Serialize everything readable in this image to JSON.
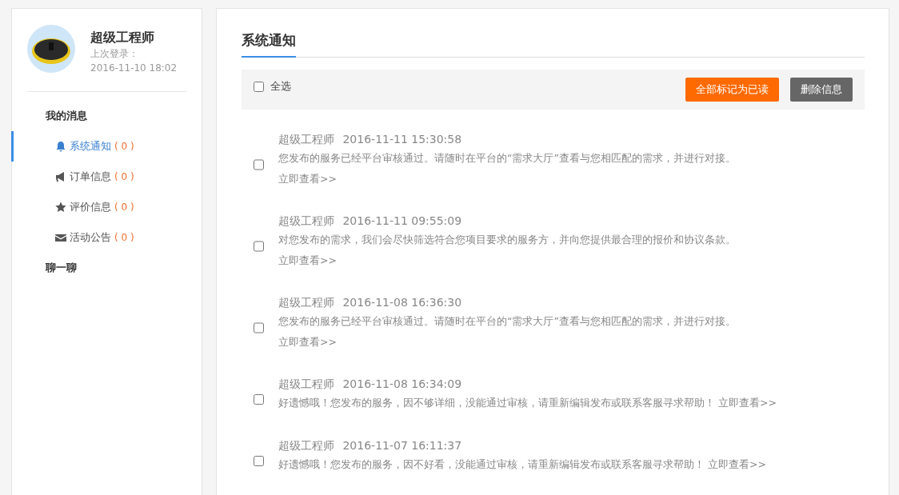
{
  "user": {
    "name": "超级工程师",
    "last_login_label": "上次登录：",
    "last_login_time": "2016-11-10 18:02"
  },
  "sidebar": {
    "sections": [
      {
        "title": "我的消息",
        "items": [
          {
            "label": "系统通知",
            "count": "( 0 )",
            "selected": true
          },
          {
            "label": "订单信息",
            "count": "( 0 )",
            "selected": false
          },
          {
            "label": "评价信息",
            "count": "( 0 )",
            "selected": false
          },
          {
            "label": "活动公告",
            "count": "( 0 )",
            "selected": false
          }
        ]
      },
      {
        "title": "聊一聊"
      }
    ]
  },
  "main": {
    "title": "系统通知",
    "select_all": {
      "label": "全选",
      "checked": false
    },
    "buttons": [
      {
        "label": "全部标记为已读",
        "kind": "primary"
      },
      {
        "label": "删除信息",
        "kind": "secondary"
      }
    ],
    "messages": [
      {
        "kind": "block",
        "sender": "超级工程师",
        "time": "2016-11-11 15:30:58",
        "text": "您发布的服务已经平台审核通过。请随时在平台的“需求大厅”查看与您相匹配的需求，并进行对接。",
        "link": "立即查看>>",
        "checked": false
      },
      {
        "kind": "block",
        "sender": "超级工程师",
        "time": "2016-11-11 09:55:09",
        "text": "对您发布的需求，我们会尽快筛选符合您项目要求的服务方，并向您提供最合理的报价和协议条款。",
        "link": "立即查看>>",
        "checked": false
      },
      {
        "kind": "block",
        "sender": "超级工程师",
        "time": "2016-11-08 16:36:30",
        "text": "您发布的服务已经平台审核通过。请随时在平台的“需求大厅”查看与您相匹配的需求，并进行对接。",
        "link": "立即查看>>",
        "checked": false
      },
      {
        "kind": "inline",
        "sender": "超级工程师",
        "time": "2016-11-08 16:34:09",
        "text": "好遗憾哦！您发布的服务，因不够详细，没能通过审核，请重新编辑发布或联系客服寻求帮助！",
        "link": "立即查看>>",
        "checked": false
      },
      {
        "kind": "inline",
        "sender": "超级工程师",
        "time": "2016-11-07 16:11:37",
        "text": "好遗憾哦！您发布的服务，因不好看，没能通过审核，请重新编辑发布或联系客服寻求帮助！",
        "link": "立即查看>>",
        "checked": false
      }
    ]
  }
}
